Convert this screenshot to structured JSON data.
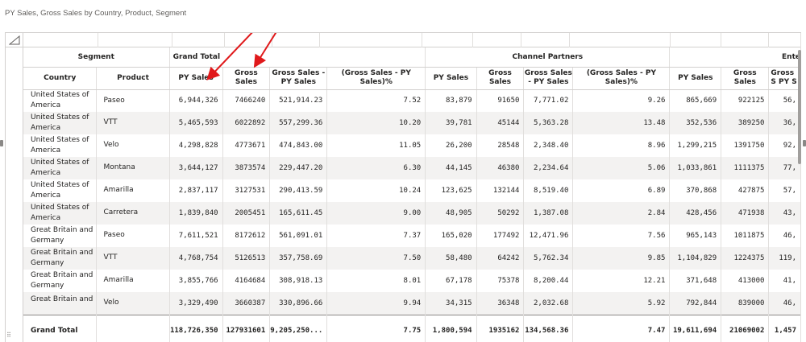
{
  "visual": {
    "title": "PY Sales, Gross Sales by Country, Product, Segment"
  },
  "headers": {
    "segment": "Segment",
    "grand_total": "Grand Total",
    "channel_partners": "Channel Partners",
    "enterprise_partial": "Ente",
    "country": "Country",
    "product": "Product",
    "py_sales": "PY Sales",
    "gross_sales": "Gross Sales",
    "gross_minus_py": "Gross Sales - PY Sales",
    "pct": "(Gross Sales - PY Sales)%",
    "gross_minus_py_partial": "Gross S PY S"
  },
  "rows": [
    {
      "country": "United States of America",
      "product": "Paseo",
      "c": [
        "6,944,326",
        "7466240",
        "521,914.23",
        "7.52",
        "83,879",
        "91650",
        "7,771.02",
        "9.26",
        "865,669",
        "922125",
        "56,"
      ]
    },
    {
      "country": "United States of America",
      "product": "VTT",
      "c": [
        "5,465,593",
        "6022892",
        "557,299.36",
        "10.20",
        "39,781",
        "45144",
        "5,363.28",
        "13.48",
        "352,536",
        "389250",
        "36,"
      ]
    },
    {
      "country": "United States of America",
      "product": "Velo",
      "c": [
        "4,298,828",
        "4773671",
        "474,843.00",
        "11.05",
        "26,200",
        "28548",
        "2,348.40",
        "8.96",
        "1,299,215",
        "1391750",
        "92,"
      ]
    },
    {
      "country": "United States of America",
      "product": "Montana",
      "c": [
        "3,644,127",
        "3873574",
        "229,447.20",
        "6.30",
        "44,145",
        "46380",
        "2,234.64",
        "5.06",
        "1,033,861",
        "1111375",
        "77,"
      ]
    },
    {
      "country": "United States of America",
      "product": "Amarilla",
      "c": [
        "2,837,117",
        "3127531",
        "290,413.59",
        "10.24",
        "123,625",
        "132144",
        "8,519.40",
        "6.89",
        "370,868",
        "427875",
        "57,"
      ]
    },
    {
      "country": "United States of America",
      "product": "Carretera",
      "c": [
        "1,839,840",
        "2005451",
        "165,611.45",
        "9.00",
        "48,905",
        "50292",
        "1,387.08",
        "2.84",
        "428,456",
        "471938",
        "43,"
      ]
    },
    {
      "country": "Great Britain and Germany",
      "product": "Paseo",
      "c": [
        "7,611,521",
        "8172612",
        "561,091.01",
        "7.37",
        "165,020",
        "177492",
        "12,471.96",
        "7.56",
        "965,143",
        "1011875",
        "46,"
      ]
    },
    {
      "country": "Great Britain and Germany",
      "product": "VTT",
      "c": [
        "4,768,754",
        "5126513",
        "357,758.69",
        "7.50",
        "58,480",
        "64242",
        "5,762.34",
        "9.85",
        "1,104,829",
        "1224375",
        "119,"
      ]
    },
    {
      "country": "Great Britain and Germany",
      "product": "Amarilla",
      "c": [
        "3,855,766",
        "4164684",
        "308,918.13",
        "8.01",
        "67,178",
        "75378",
        "8,200.44",
        "12.21",
        "371,648",
        "413000",
        "41,"
      ]
    },
    {
      "country": "Great Britain and Germany",
      "product": "Velo",
      "c": [
        "3,329,490",
        "3660387",
        "330,896.66",
        "9.94",
        "34,315",
        "36348",
        "2,032.68",
        "5.92",
        "792,844",
        "839000",
        "46,"
      ]
    }
  ],
  "total": {
    "label": "Grand Total",
    "c": [
      "118,726,350",
      "127931601",
      "9,205,250...",
      "7.75",
      "1,800,594",
      "1935162",
      "134,568.36",
      "7.47",
      "19,611,694",
      "21069002",
      "1,457"
    ]
  },
  "colors": {
    "arrow": "#e0191b",
    "grid": "#e1dfdd",
    "band": "#f3f2f1"
  },
  "icons": {
    "corner": "resize-corner-icon",
    "grip": "drag-grip-icon"
  }
}
